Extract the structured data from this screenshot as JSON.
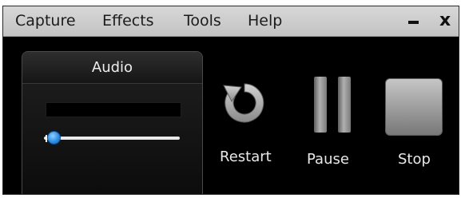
{
  "menubar": {
    "items": [
      {
        "label": "Capture"
      },
      {
        "label": "Effects"
      },
      {
        "label": "Tools"
      },
      {
        "label": "Help"
      }
    ],
    "minimize_icon": "minimize-icon",
    "close_label": "x"
  },
  "audio": {
    "title": "Audio",
    "volume_fraction": 0.07
  },
  "controls": {
    "restart": {
      "label": "Restart",
      "icon": "restart-icon"
    },
    "pause": {
      "label": "Pause",
      "icon": "pause-icon"
    },
    "stop": {
      "label": "Stop",
      "icon": "stop-icon"
    }
  },
  "colors": {
    "background": "#000000",
    "menubar": "#cfcfcf",
    "slider_knob": "#2f8ee2",
    "text": "#e8e8e8"
  }
}
